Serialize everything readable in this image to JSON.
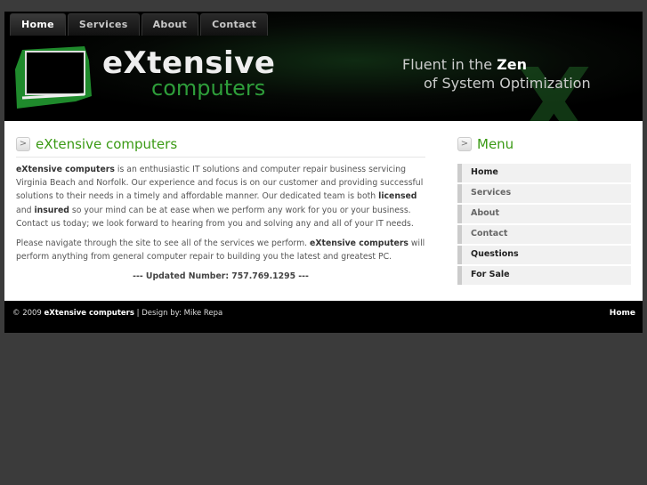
{
  "nav": {
    "tabs": [
      "Home",
      "Services",
      "About",
      "Contact"
    ],
    "active": "Home"
  },
  "header": {
    "logo_main": "eXtensive",
    "logo_sub": "computers",
    "tagline_1_pre": "Fluent in the ",
    "tagline_1_bold": "Zen",
    "tagline_2": "of System Optimization"
  },
  "main": {
    "title": "eXtensive computers",
    "p1_bold": "eXtensive computers",
    "p1_a": " is an enthusiastic IT solutions and computer repair business servicing Virginia Beach and Norfolk. Our experience and focus is on our customer and providing successful solutions to their needs in a timely and affordable manner. Our dedicated team is both ",
    "p1_licensed": "licensed",
    "p1_and": " and ",
    "p1_insured": "insured",
    "p1_b": " so your mind can be at ease when we perform any work for you or your business. Contact us today; we look forward to hearing from you and solving any and all of your IT needs.",
    "p2_a": "Please navigate through the site to see all of the services we perform. ",
    "p2_bold": "eXtensive computers",
    "p2_b": " will perform anything from general computer repair to building you the latest and greatest PC.",
    "updated": "--- Updated Number: 757.769.1295 ---"
  },
  "sidebar": {
    "title": "Menu",
    "items": [
      "Home",
      "Services",
      "About",
      "Contact",
      "Questions",
      "For Sale"
    ]
  },
  "footer": {
    "copyright": "© 2009 ",
    "brand": "eXtensive computers",
    "design": " | Design by: Mike Repa",
    "home_link": "Home"
  },
  "colors": {
    "accent": "#3a9a14",
    "page_bg": "#3b3b3b"
  }
}
